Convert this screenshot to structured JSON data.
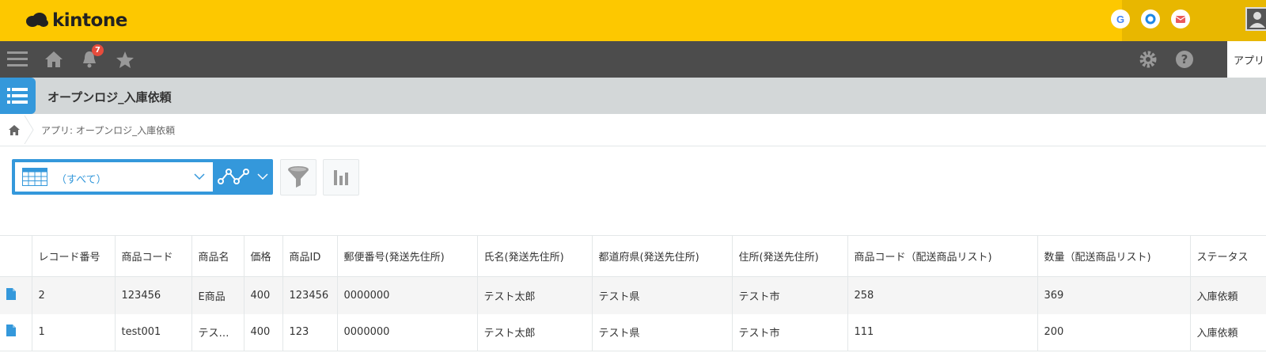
{
  "header": {
    "logo_text": "kintone",
    "buttons": [
      {
        "name": "google-icon",
        "glyph": "G",
        "color": "#4285f4"
      },
      {
        "name": "garoon-icon",
        "glyph": "O",
        "color": "#1e88e5"
      },
      {
        "name": "mail-icon",
        "glyph": "✉",
        "color": "#e74c3c"
      }
    ]
  },
  "navbar": {
    "notification_count": "7",
    "app_tab_label": "アプリ"
  },
  "app": {
    "title": "オープンロジ_入庫依頼"
  },
  "breadcrumb": {
    "text": "アプリ: オープンロジ_入庫依頼"
  },
  "toolbar": {
    "view_label": "（すべて）"
  },
  "table": {
    "columns": [
      "",
      "レコード番号",
      "商品コード",
      "商品名",
      "価格",
      "商品ID",
      "郵便番号(発送先住所)",
      "氏名(発送先住所)",
      "都道府県(発送先住所)",
      "住所(発送先住所)",
      "商品コード（配送商品リスト)",
      "数量（配送商品リスト)",
      "ステータス"
    ],
    "rows": [
      [
        "",
        "2",
        "123456",
        "E商品",
        "400",
        "123456",
        "0000000",
        "テスト太郎",
        "テスト県",
        "テスト市",
        "258",
        "369",
        "入庫依頼"
      ],
      [
        "",
        "1",
        "test001",
        "テス…",
        "400",
        "123",
        "0000000",
        "テスト太郎",
        "テスト県",
        "テスト市",
        "111",
        "200",
        "入庫依頼"
      ]
    ]
  },
  "colors": {
    "brand_yellow": "#fdc800",
    "nav_gray": "#4c4c4c",
    "accent_blue": "#3498db"
  }
}
